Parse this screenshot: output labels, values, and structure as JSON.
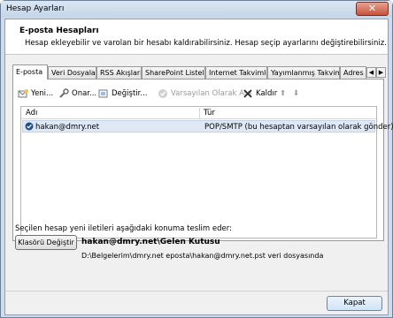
{
  "window": {
    "title": "Hesap Ayarları",
    "close_glyph": "✕"
  },
  "header": {
    "title": "E-posta Hesapları",
    "description": "Hesap ekleyebilir ve varolan bir hesabı kaldırabilirsiniz. Hesap seçip ayarlarını değiştirebilirsiniz."
  },
  "tabs": [
    {
      "label": "E-posta",
      "active": true
    },
    {
      "label": "Veri Dosyaları"
    },
    {
      "label": "RSS Akışları"
    },
    {
      "label": "SharePoint Listeleri"
    },
    {
      "label": "Internet Takvimleri"
    },
    {
      "label": "Yayımlanmış Takvimler"
    },
    {
      "label": "Adres De"
    }
  ],
  "tab_scroll": {
    "left": "◀",
    "right": "▶"
  },
  "toolbar": {
    "new": "Yeni...",
    "repair": "Onar...",
    "change": "Değiştir...",
    "set_default": "Varsayılan Olarak Ata",
    "remove": "Kaldır",
    "up_glyph": "⬆",
    "down_glyph": "⬇"
  },
  "accounts": {
    "columns": [
      "Adı",
      "Tür"
    ],
    "rows": [
      {
        "name": "hakan@dmry.net",
        "type": "POP/SMTP (bu hesaptan varsayılan olarak gönder)",
        "default": true
      }
    ]
  },
  "delivery": {
    "label": "Seçilen hesap yeni iletileri aşağıdaki konuma teslim eder:",
    "change_folder": "Klasörü Değiştir",
    "target": "hakan@dmry.net\\Gelen Kutusu",
    "path": "D:\\Belgelerim\\dmry.net eposta\\hakan@dmry.net.pst veri dosyasında"
  },
  "footer": {
    "close": "Kapat"
  },
  "colors": {
    "window_frame": "#cfdcec",
    "selected_row": "#dfe9f6",
    "accent": "#4a8fc7"
  }
}
